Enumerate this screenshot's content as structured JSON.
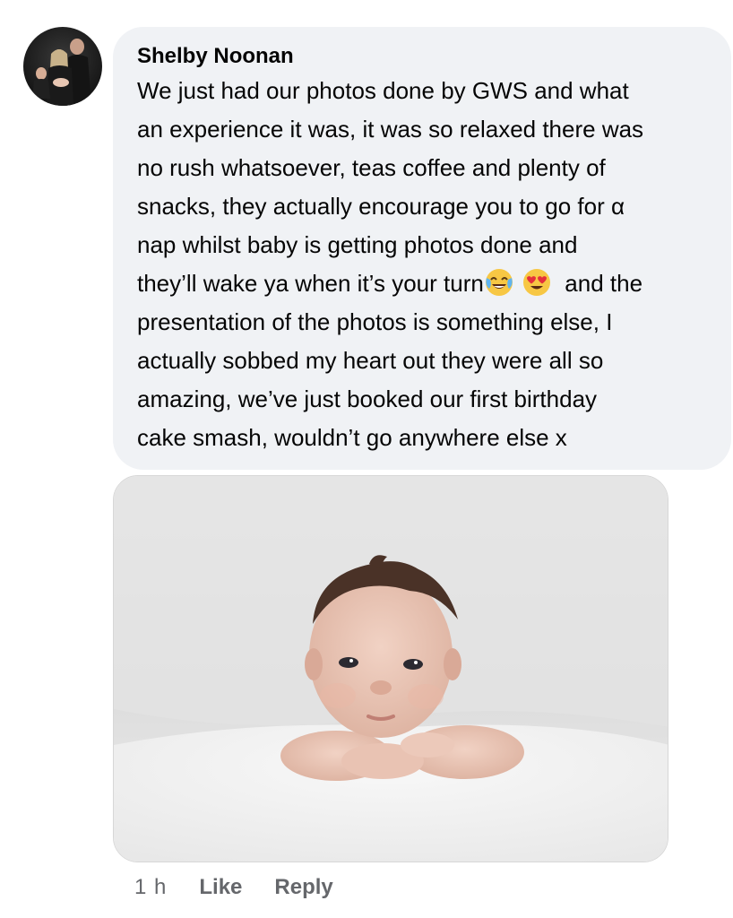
{
  "comment": {
    "author": "Shelby Noonan",
    "lines": [
      "We just had our photos done by GWS and what",
      "an experience it was, it was so relaxed there was",
      "no rush whatsoever, teas coffee and plenty of",
      "snacks, they actually encourage you to go for α",
      "nap whilst baby is getting photos done and"
    ],
    "line6_text": "they’ll wake ya when it’s your turn",
    "line6_emoji_1": "face-with-tears-of-joy-icon",
    "line6_emoji_2": "smiling-face-with-heart-eyes-icon",
    "line6_tail": "and the",
    "lines_after": [
      "presentation of the photos is something else, I",
      "actually sobbed my heart out they were all so",
      "amazing, we’ve just booked our first birthday",
      "cake smash, wouldn’t go anywhere else x"
    ]
  },
  "actions": {
    "time": "1 h",
    "like": "Like",
    "reply": "Reply"
  },
  "colors": {
    "bubble": "#f0f2f5",
    "text": "#050505",
    "secondary": "#65676b"
  }
}
